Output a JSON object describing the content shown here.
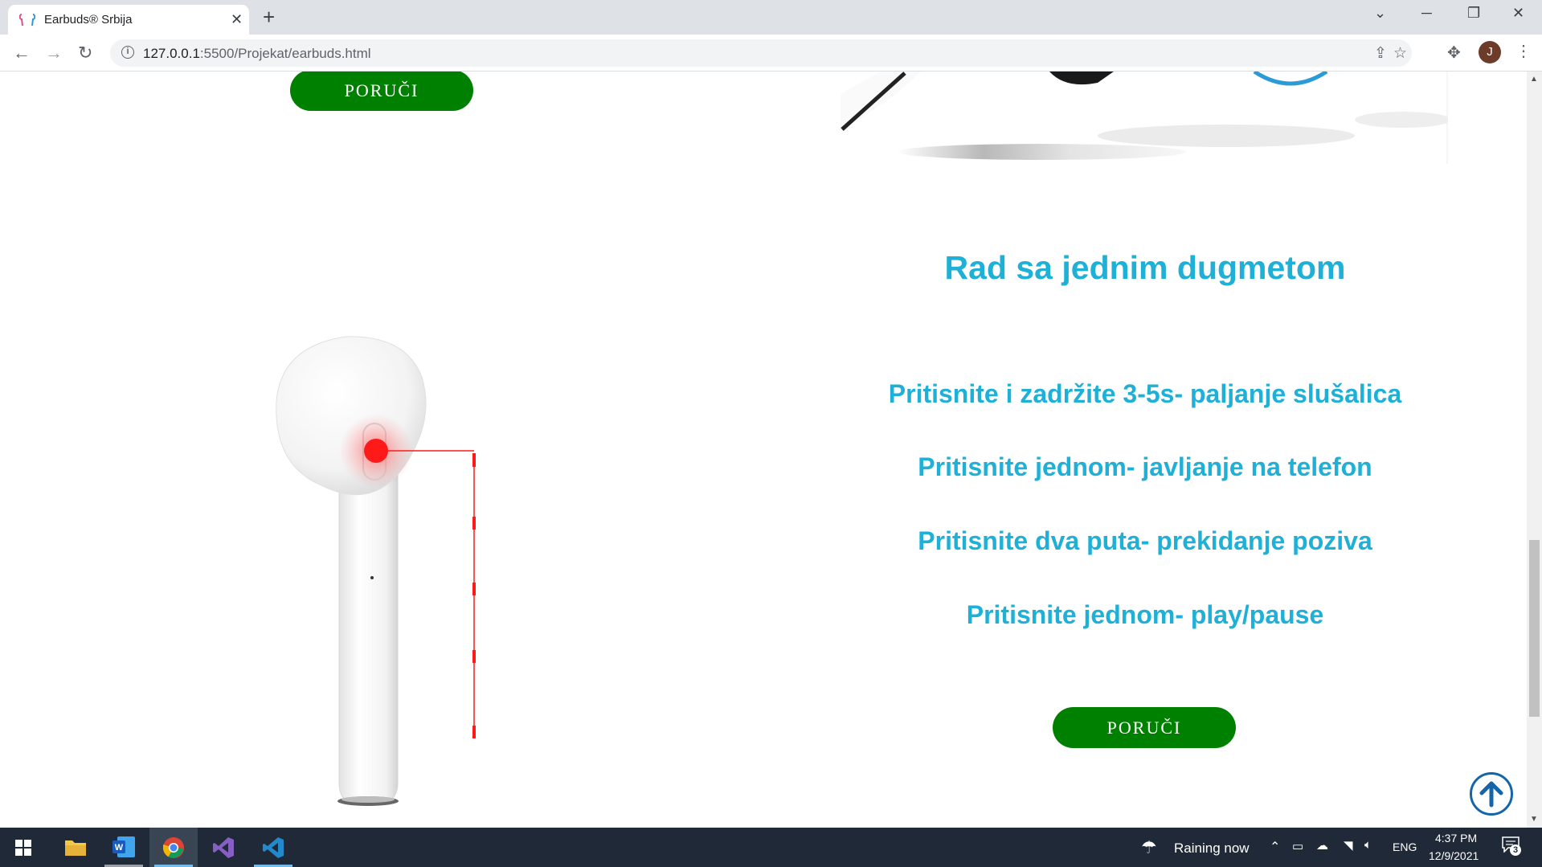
{
  "browser": {
    "tab_title": "Earbuds® Srbija",
    "url_host": "127.0.0.1",
    "url_rest": ":5500/Projekat/earbuds.html"
  },
  "page": {
    "order_button_top": "PORUČI",
    "section_heading": "Rad sa jednim dugmetom",
    "instructions": [
      "Pritisnite i zadržite 3-5s- paljanje slušalica",
      "Pritisnite jednom- javljanje na telefon",
      "Pritisnite dva puta- prekidanje poziva",
      "Pritisnite jednom- play/pause"
    ],
    "order_button_bottom": "PORUČI"
  },
  "taskbar": {
    "weather": "Raining now",
    "language": "ENG",
    "time": "4:37 PM",
    "date": "12/9/2021",
    "notification_count": "3"
  },
  "colors": {
    "accent_text": "#1fb0d8",
    "order_button": "#008000",
    "indicator_red": "#ff1a1a"
  }
}
